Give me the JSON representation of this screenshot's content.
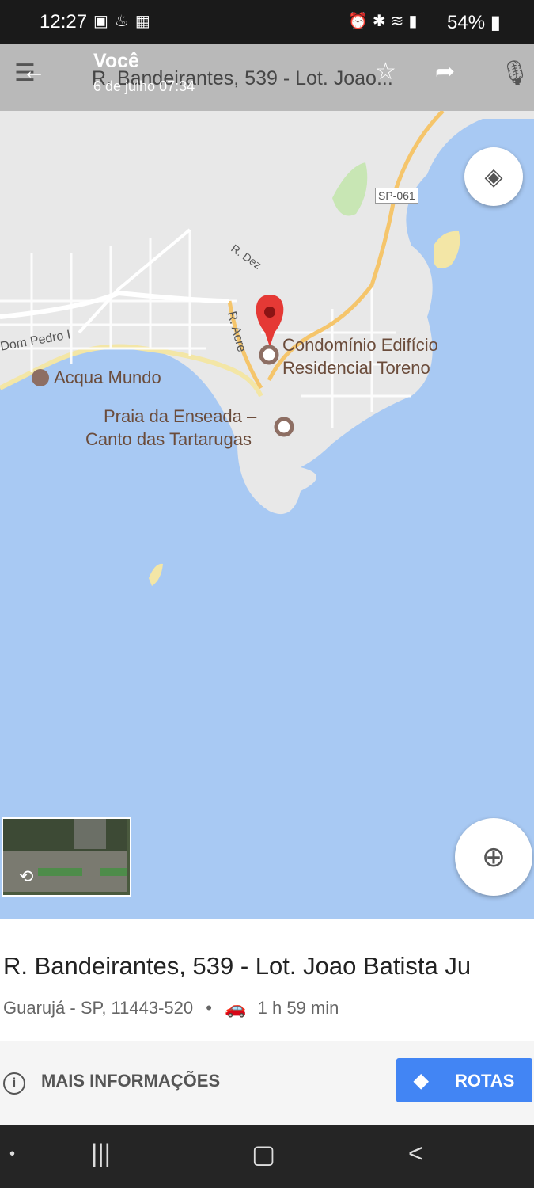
{
  "status_bar": {
    "time": "12:27",
    "left_icons": [
      "photo-icon",
      "app-icon",
      "gallery-icon"
    ],
    "right_icons": [
      "alarm-icon",
      "bluetooth-icon",
      "wifi-icon",
      "signal-icon"
    ],
    "battery": "54%"
  },
  "top_bar": {
    "title": "Você",
    "subtitle": "6 de julho 07:34",
    "address_behind": "R. Bandeirantes, 539 - Lot. Joao..."
  },
  "map": {
    "labels": {
      "road_sp": "SP-061",
      "r_dez": "R. Dez",
      "r_acre": "R. Acre",
      "dom_pedro": "Dom Pedro I",
      "acqua": "Acqua Mundo",
      "condo_line1": "Condomínio Edifício",
      "condo_line2": "Residencial Toreno",
      "praia_line1": "Praia da Enseada –",
      "praia_line2": "Canto das Tartarugas"
    },
    "water_color": "#a8c9f3",
    "land_color": "#e8e8e8",
    "road_color": "#f5c56b",
    "pin_color": "#e53935"
  },
  "card": {
    "address": "R. Bandeirantes, 539 - Lot. Joao Batista Ju",
    "location": "Guarujá - SP, 11443-520",
    "separator": "•",
    "travel_time": "1 h 59 min",
    "more_info": "MAIS INFORMAÇÕES",
    "directions": "ROTAS"
  },
  "accent": "#4285f4"
}
